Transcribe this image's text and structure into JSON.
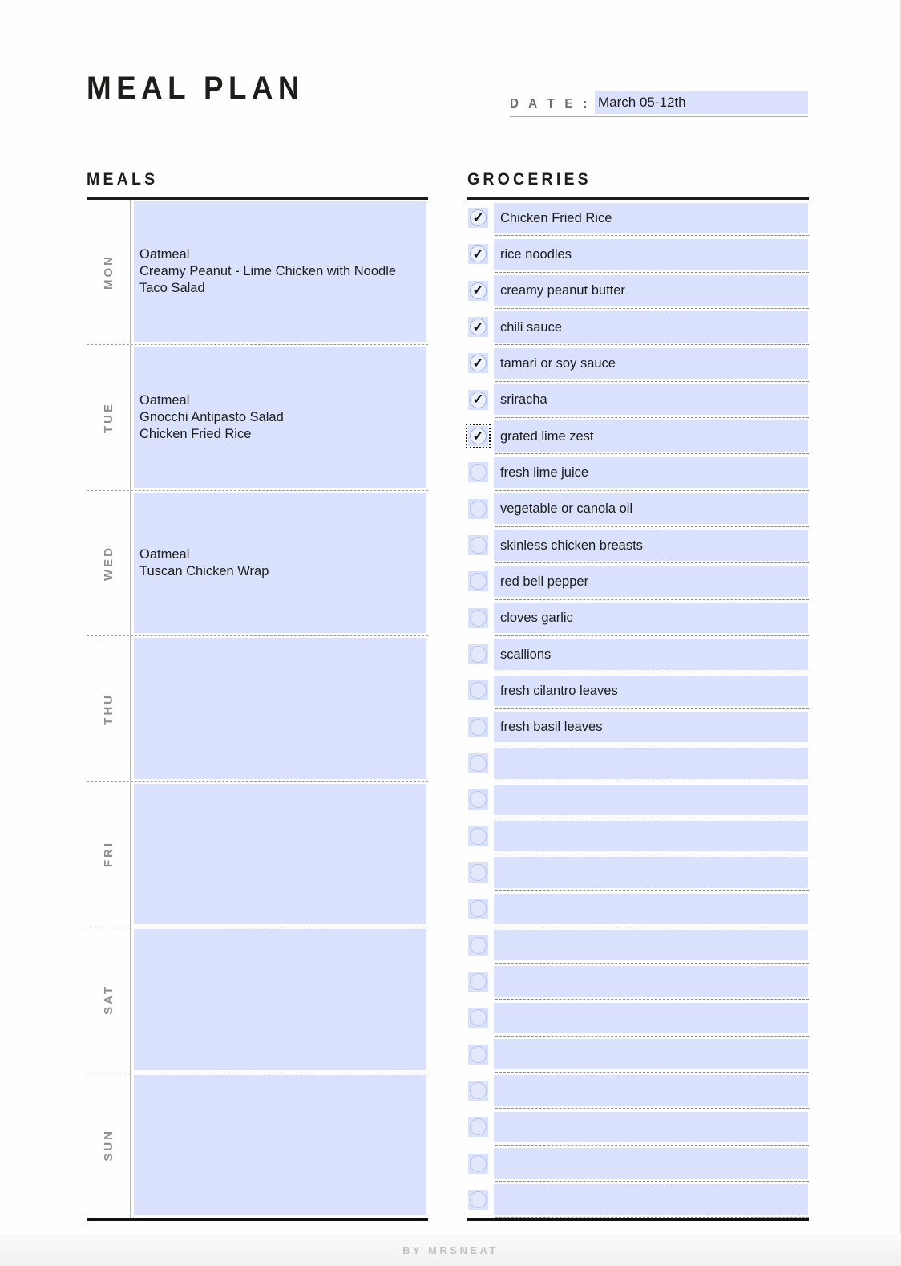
{
  "document": {
    "title": "MEAL PLAN",
    "footer_credit": "BY MRSNEAT"
  },
  "date": {
    "label": "D A T E :",
    "value": "March 05-12th",
    "placeholder": ""
  },
  "meals": {
    "heading": "MEALS",
    "rows": [
      {
        "day": "MON",
        "entries": "Oatmeal\nCreamy Peanut - Lime Chicken with Noodle\nTaco Salad"
      },
      {
        "day": "TUE",
        "entries": "Oatmeal\nGnocchi Antipasto Salad\nChicken Fried Rice"
      },
      {
        "day": "WED",
        "entries": "Oatmeal\nTuscan Chicken Wrap"
      },
      {
        "day": "THU",
        "entries": ""
      },
      {
        "day": "FRI",
        "entries": ""
      },
      {
        "day": "SAT",
        "entries": ""
      },
      {
        "day": "SUN",
        "entries": ""
      }
    ]
  },
  "groceries": {
    "heading": "GROCERIES",
    "items": [
      {
        "label": "Chicken Fried Rice",
        "checked": true,
        "focused": false
      },
      {
        "label": "rice noodles",
        "checked": true,
        "focused": false
      },
      {
        "label": "creamy peanut butter",
        "checked": true,
        "focused": false
      },
      {
        "label": "chili sauce",
        "checked": true,
        "focused": false
      },
      {
        "label": "tamari or soy sauce",
        "checked": true,
        "focused": false
      },
      {
        "label": "sriracha",
        "checked": true,
        "focused": false
      },
      {
        "label": "grated lime zest",
        "checked": true,
        "focused": true
      },
      {
        "label": "fresh lime juice",
        "checked": false,
        "focused": false
      },
      {
        "label": "vegetable or canola oil",
        "checked": false,
        "focused": false
      },
      {
        "label": "skinless chicken breasts",
        "checked": false,
        "focused": false
      },
      {
        "label": "red bell pepper",
        "checked": false,
        "focused": false
      },
      {
        "label": "cloves garlic",
        "checked": false,
        "focused": false
      },
      {
        "label": "scallions",
        "checked": false,
        "focused": false
      },
      {
        "label": "fresh cilantro leaves",
        "checked": false,
        "focused": false
      },
      {
        "label": "fresh basil leaves",
        "checked": false,
        "focused": false
      },
      {
        "label": "",
        "checked": false,
        "focused": false
      },
      {
        "label": "",
        "checked": false,
        "focused": false
      },
      {
        "label": "",
        "checked": false,
        "focused": false
      },
      {
        "label": "",
        "checked": false,
        "focused": false
      },
      {
        "label": "",
        "checked": false,
        "focused": false
      },
      {
        "label": "",
        "checked": false,
        "focused": false
      },
      {
        "label": "",
        "checked": false,
        "focused": false
      },
      {
        "label": "",
        "checked": false,
        "focused": false
      },
      {
        "label": "",
        "checked": false,
        "focused": false
      },
      {
        "label": "",
        "checked": false,
        "focused": false
      },
      {
        "label": "",
        "checked": false,
        "focused": false
      },
      {
        "label": "",
        "checked": false,
        "focused": false
      },
      {
        "label": "",
        "checked": false,
        "focused": false
      }
    ],
    "check_glyph": "✓"
  },
  "theme": {
    "field_fill": "#dae1fc",
    "rule_color": "#1d1d1b",
    "day_label_color": "#8f8f8f",
    "footer_color": "#c2c2c2"
  }
}
